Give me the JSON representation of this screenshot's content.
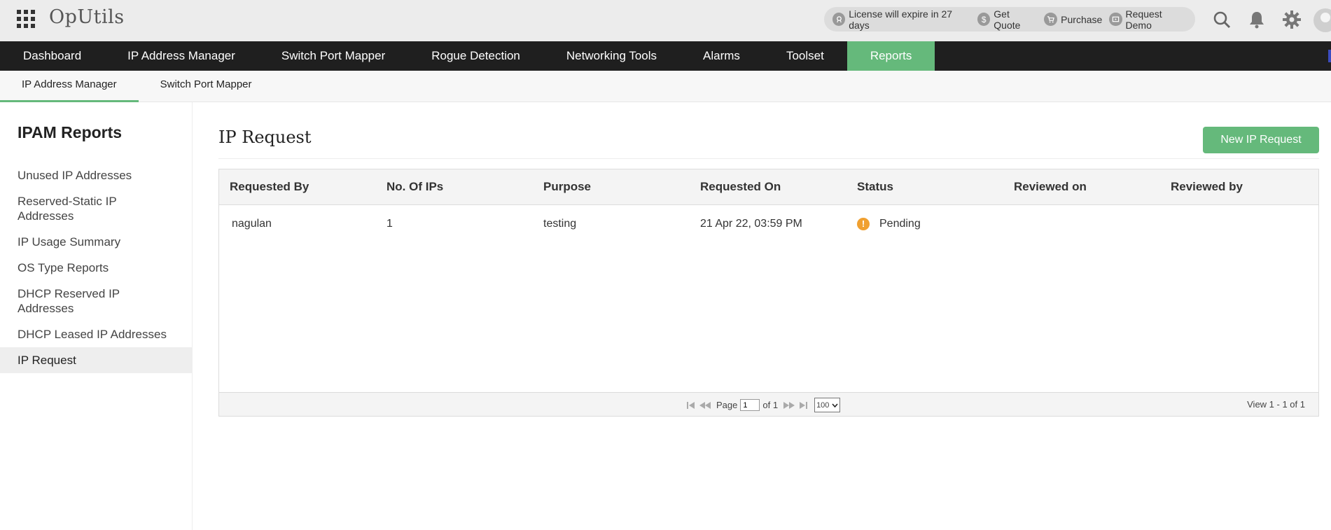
{
  "header": {
    "app_name": "OpUtils",
    "license_text": "License will expire in 27 days",
    "get_quote": "Get Quote",
    "purchase": "Purchase",
    "request_demo": "Request Demo",
    "icons": [
      "apps-grid-icon",
      "search-icon",
      "bell-icon",
      "gear-icon",
      "user-avatar"
    ]
  },
  "nav": {
    "items": [
      {
        "label": "Dashboard"
      },
      {
        "label": "IP Address Manager"
      },
      {
        "label": "Switch Port Mapper"
      },
      {
        "label": "Rogue Detection"
      },
      {
        "label": "Networking Tools"
      },
      {
        "label": "Alarms"
      },
      {
        "label": "Toolset"
      },
      {
        "label": "Reports"
      }
    ],
    "active": "Reports"
  },
  "subnav": {
    "items": [
      {
        "label": "IP Address Manager"
      },
      {
        "label": "Switch Port Mapper"
      }
    ],
    "active": "IP Address Manager"
  },
  "sidebar": {
    "title": "IPAM Reports",
    "items": [
      {
        "label": "Unused IP Addresses"
      },
      {
        "label": "Reserved-Static IP Addresses"
      },
      {
        "label": "IP Usage Summary"
      },
      {
        "label": "OS Type Reports"
      },
      {
        "label": "DHCP Reserved IP Addresses"
      },
      {
        "label": "DHCP Leased IP Addresses"
      },
      {
        "label": "IP Request"
      }
    ],
    "active": "IP Request"
  },
  "main": {
    "title": "IP Request",
    "new_button": "New IP Request",
    "columns": [
      "Requested By",
      "No. Of IPs",
      "Purpose",
      "Requested On",
      "Status",
      "Reviewed on",
      "Reviewed by"
    ],
    "rows": [
      {
        "requested_by": "nagulan",
        "num_ips": "1",
        "purpose": "testing",
        "requested_on": "21 Apr 22, 03:59 PM",
        "status": "Pending",
        "reviewed_on": "",
        "reviewed_by": ""
      }
    ],
    "status_colors": {
      "pending": "#f0a030"
    },
    "pager": {
      "page_label": "Page",
      "page_value": "1",
      "of_label": "of 1",
      "page_size": "100",
      "view_text": "View 1 - 1 of 1"
    }
  },
  "colors": {
    "accent": "#65b97b",
    "nav_bg": "#1f1f1f",
    "header_bg": "#ececec"
  }
}
